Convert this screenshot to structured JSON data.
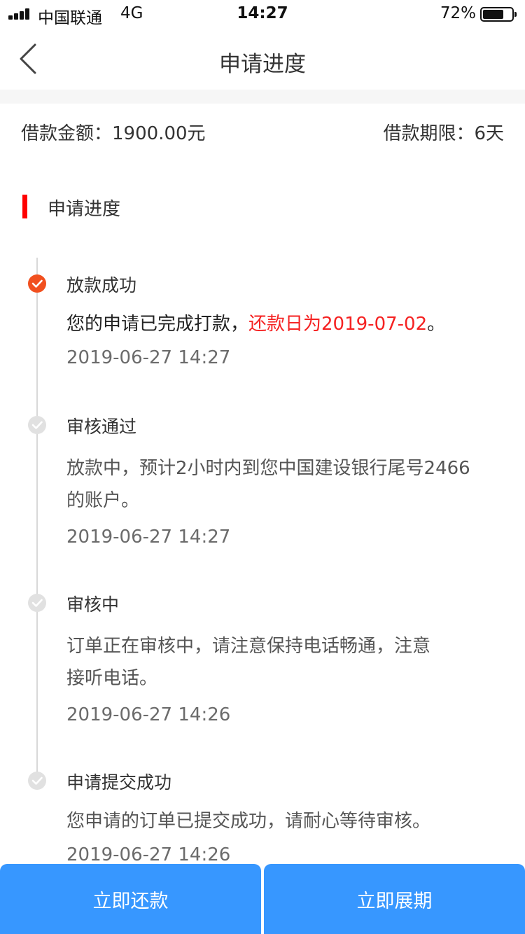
{
  "status_bar": {
    "carrier": "中国联通",
    "network": "4G",
    "time": "14:27",
    "battery_pct": "72%",
    "battery_level": 0.72
  },
  "nav": {
    "back_icon": "chevron-left-icon",
    "title": "申请进度"
  },
  "loan": {
    "amount_label": "借款金额：",
    "amount_value": "1900.00元",
    "term_label": "借款期限：",
    "term_value": "6天"
  },
  "section": {
    "title": "申请进度",
    "accent_color": "#ff0000"
  },
  "steps": [
    {
      "title": "放款成功",
      "desc_prefix": "您的申请已完成打款，",
      "desc_highlight": "还款日为2019-07-02",
      "desc_suffix": "。",
      "time": "2019-06-27 14:27",
      "state": "done",
      "icon": "check-circle-icon"
    },
    {
      "title": "审核通过",
      "desc_line1": "放款中，预计2小时内到您中国建设银行尾号2466",
      "desc_line2": "的账户。",
      "time": "2019-06-27 14:27",
      "state": "past",
      "icon": "check-circle-icon"
    },
    {
      "title": "审核中",
      "desc_line1": "订单正在审核中，请注意保持电话畅通，注意",
      "desc_line2": "接听电话。",
      "time": "2019-06-27 14:26",
      "state": "past",
      "icon": "check-circle-icon"
    },
    {
      "title": "申请提交成功",
      "desc_line1": "您申请的订单已提交成功，请耐心等待审核。",
      "time": "2019-06-27 14:26",
      "state": "past",
      "icon": "check-circle-icon"
    }
  ],
  "actions": {
    "repay_label": "立即还款",
    "extend_label": "立即展期",
    "button_color": "#3797ff"
  },
  "colors": {
    "active_step": "#f1501f",
    "highlight_text": "#f52222",
    "inactive_step": "#e1e1e1"
  }
}
